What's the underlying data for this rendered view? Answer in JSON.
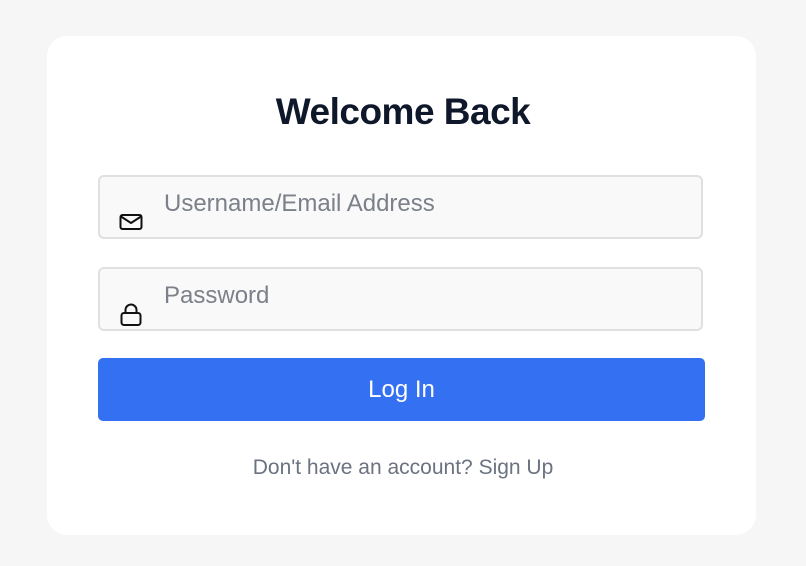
{
  "login": {
    "title": "Welcome Back",
    "username_placeholder": "Username/Email Address",
    "username_value": "",
    "password_placeholder": "Password",
    "password_value": "",
    "login_label": "Log In",
    "signup_prompt": "Don't have an account?",
    "signup_link": "Sign Up"
  },
  "icons": {
    "username": "envelope-icon",
    "password": "lock-icon"
  },
  "colors": {
    "page_background": "#f6f6f6",
    "card_background": "#ffffff",
    "primary_button": "#3370f2",
    "title_text": "#0f172a",
    "muted_text": "#6b7280"
  }
}
